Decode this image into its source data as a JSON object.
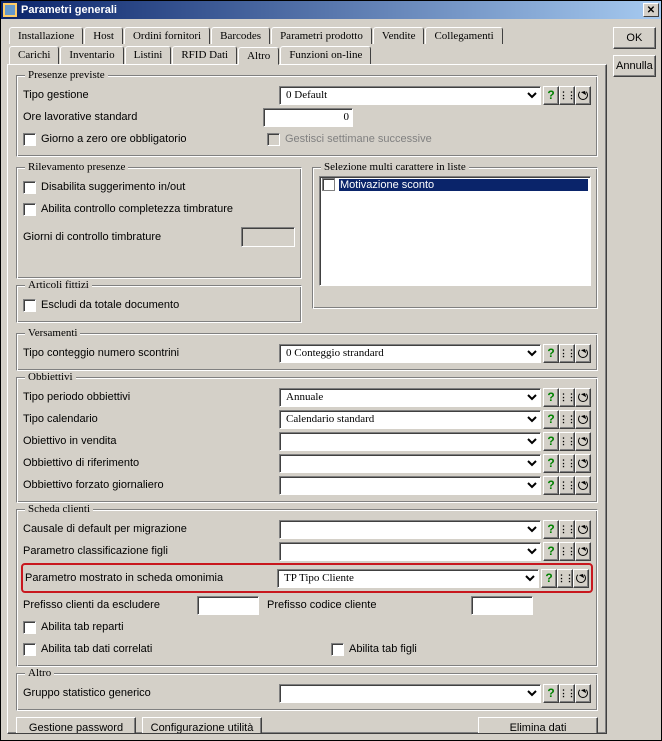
{
  "window": {
    "title": "Parametri generali",
    "close_x": "✕"
  },
  "side_buttons": {
    "ok": "OK",
    "cancel": "Annulla"
  },
  "tabs_row1": [
    "Installazione",
    "Host",
    "Ordini fornitori",
    "Barcodes",
    "Parametri prodotto",
    "Vendite",
    "Collegamenti"
  ],
  "tabs_row2": [
    "Carichi",
    "Inventario",
    "Listini",
    "RFID Dati",
    "Altro",
    "Funzioni on-line"
  ],
  "tabs_row2_active_index": 4,
  "presenze": {
    "legend": "Presenze previste",
    "tipo_gestione_label": "Tipo gestione",
    "tipo_gestione_value": "0 Default",
    "ore_label": "Ore lavorative standard",
    "ore_value": "0",
    "cb_zero": "Giorno a zero ore obbligatorio",
    "cb_gestisci": "Gestisci settimane successive"
  },
  "rilevamento": {
    "legend": "Rilevamento presenze",
    "cb_disable": "Disabilita suggerimento in/out",
    "cb_completezza": "Abilita controllo completezza timbrature",
    "giorni_label": "Giorni di controllo timbrature"
  },
  "selezione": {
    "legend": "Selezione multi carattere in liste",
    "item0": "Motivazione sconto"
  },
  "articoli": {
    "legend": "Articoli fittizi",
    "cb_escludi": "Escludi da totale documento"
  },
  "versamenti": {
    "legend": "Versamenti",
    "tipo_label": "Tipo conteggio numero scontrini",
    "tipo_value": "0 Conteggio strandard"
  },
  "obbiettivi": {
    "legend": "Obbiettivi",
    "periodo_label": "Tipo periodo obbiettivi",
    "periodo_value": "Annuale",
    "calendario_label": "Tipo calendario",
    "calendario_value": "Calendario standard",
    "vendita_label": "Obiettivo in vendita",
    "rifer_label": "Obbiettivo di riferimento",
    "forzato_label": "Obbiettivo forzato giornaliero"
  },
  "scheda": {
    "legend": "Scheda clienti",
    "causale_label": "Causale di default per migrazione",
    "classif_label": "Parametro classificazione figli",
    "omonimia_label": "Parametro mostrato in scheda omonimia",
    "omonimia_value": "TP Tipo Cliente",
    "pref_escl_label": "Prefisso clienti da escludere",
    "pref_cod_label": "Prefisso codice cliente",
    "cb_reparti": "Abilita tab reparti",
    "cb_correlati": "Abilita tab dati correlati",
    "cb_figli": "Abilita tab figli"
  },
  "altro": {
    "legend": "Altro",
    "gruppo_label": "Gruppo statistico generico"
  },
  "bottom": {
    "gestione_pwd": "Gestione password",
    "config_utilita": "Configurazione utilità",
    "elimina": "Elimina dati"
  },
  "icons": {
    "qmark": "?",
    "plusminus": "+\n−",
    "dots": "⋮⋮"
  }
}
